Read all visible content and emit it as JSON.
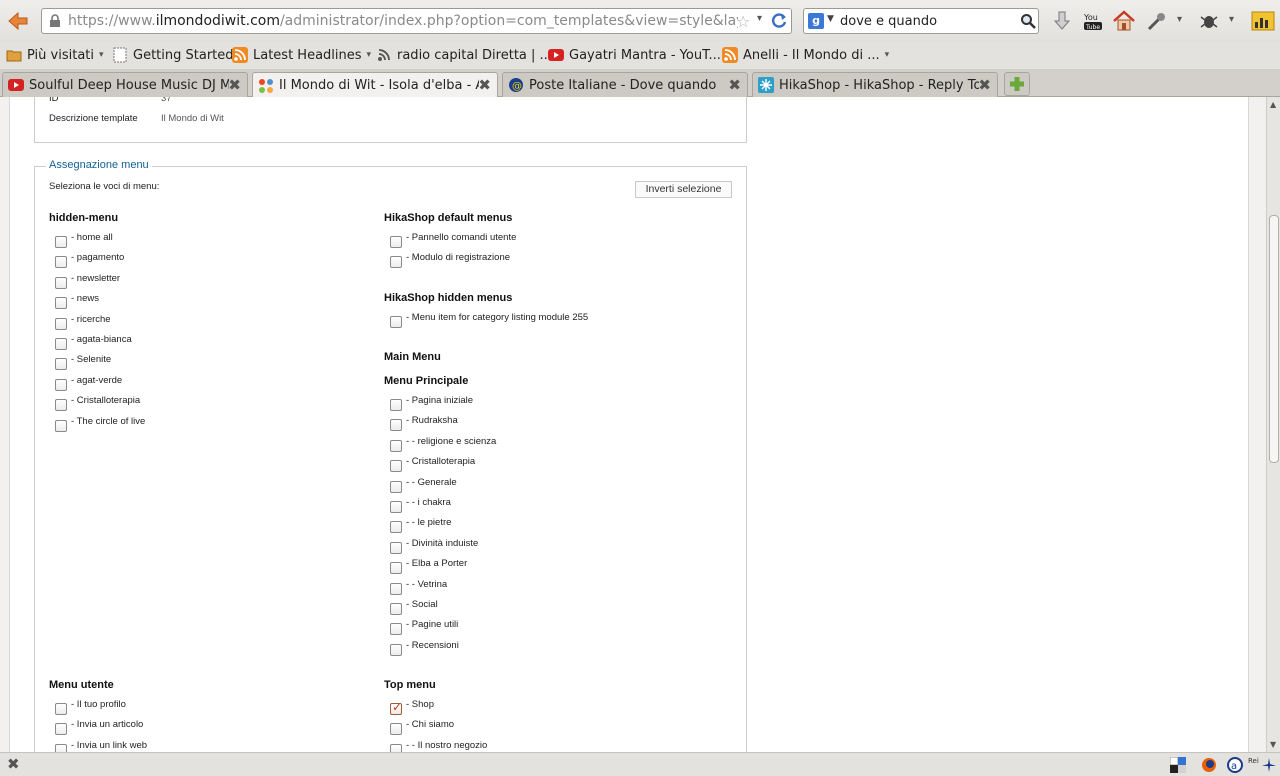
{
  "navbar": {
    "url_prefix": "https://www.",
    "url_domain": "ilmondodiwit.com",
    "url_rest": "/administrator/index.php?option=com_templates&view=style&layout=edit&id=",
    "search_value": "dove e quando",
    "search_engine": "g"
  },
  "bookmarks": [
    {
      "label": "Più visitati",
      "icon": "folder-icon",
      "caret": "▾"
    },
    {
      "label": "Getting Started",
      "icon": "page-icon"
    },
    {
      "label": "Latest Headlines",
      "icon": "rss-icon",
      "caret": "▾"
    },
    {
      "label": "radio capital Diretta | ...",
      "icon": "feed-icon"
    },
    {
      "label": "Gayatri Mantra - YouT...",
      "icon": "youtube-icon"
    },
    {
      "label": "Anelli - Il Mondo di ...",
      "icon": "rss-icon",
      "caret": "▾"
    }
  ],
  "tabs": [
    {
      "title": "Soulful Deep House Music DJ Mi...",
      "icon": "youtube-icon"
    },
    {
      "title": "Il Mondo di Wit - Isola d'elba - A...",
      "icon": "joomla-icon"
    },
    {
      "title": "Poste Italiane - Dove quando",
      "icon": "poste-icon"
    },
    {
      "title": "HikaShop - HikaShop - Reply To...",
      "icon": "hikashop-icon"
    }
  ],
  "details": {
    "id_label": "ID",
    "id_value": "37",
    "desc_label": "Descrizione template",
    "desc_value": "Il Mondo di Wit"
  },
  "assignment": {
    "legend": "Assegnazione menu",
    "prompt": "Seleziona le voci di menu:",
    "invert_label": "Inverti selezione",
    "hidden_menu": {
      "title": "hidden-menu",
      "items": [
        "- home all",
        "- pagamento",
        "- newsletter",
        "- news",
        "- ricerche",
        "- agata-bianca",
        "- Selenite",
        "- agat-verde",
        "- Cristalloterapia",
        "- The circle of live"
      ]
    },
    "hika_default": {
      "title": "HikaShop default menus",
      "items": [
        "- Pannello comandi utente",
        "- Modulo di registrazione"
      ]
    },
    "hika_hidden": {
      "title": "HikaShop hidden menus",
      "items": [
        "- Menu item for category listing module 255"
      ]
    },
    "main_menu_title": "Main Menu",
    "menu_principale": {
      "title": "Menu Principale",
      "items": [
        "- Pagina iniziale",
        "- Rudraksha",
        "- - religione e scienza",
        "- Cristalloterapia",
        "- - Generale",
        "- - i chakra",
        "- - le pietre",
        "- Divinità induiste",
        "- Elba a Porter",
        "- - Vetrina",
        "- Social",
        "- Pagine utili",
        "- Recensioni"
      ]
    },
    "menu_utente": {
      "title": "Menu utente",
      "items": [
        "- Il tuo profilo",
        "- Invia un articolo",
        "- Invia un link web"
      ]
    },
    "top_menu": {
      "title": "Top menu",
      "items": [
        "- Shop",
        "- Chi siamo",
        "- - Il nostro negozio"
      ],
      "checked": [
        true,
        false,
        false
      ]
    }
  },
  "status": {
    "addon_label": "Rei"
  }
}
